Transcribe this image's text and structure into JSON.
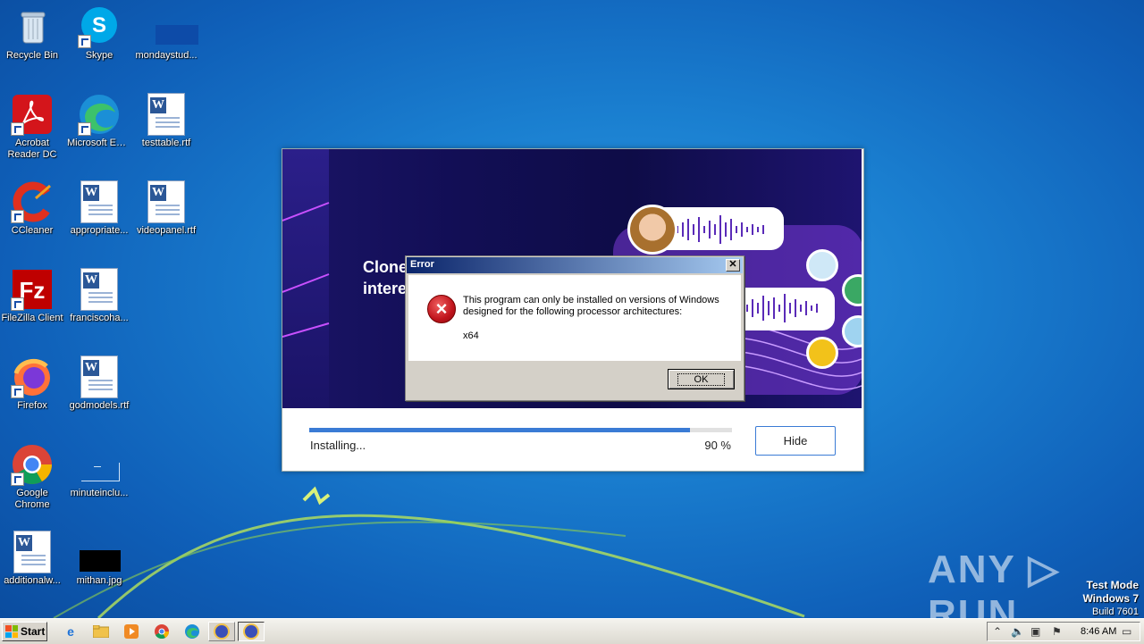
{
  "desktop": {
    "icons": [
      {
        "label": "Recycle Bin"
      },
      {
        "label": "Skype"
      },
      {
        "label": "mondaystud..."
      },
      {
        "label": "Acrobat Reader DC"
      },
      {
        "label": "Microsoft Edge"
      },
      {
        "label": "testtable.rtf"
      },
      {
        "label": "CCleaner"
      },
      {
        "label": "appropriate..."
      },
      {
        "label": "videopanel.rtf"
      },
      {
        "label": "FileZilla Client"
      },
      {
        "label": "franciscoha..."
      },
      {
        "label": "Firefox"
      },
      {
        "label": "godmodels.rtf"
      },
      {
        "label": "Google Chrome"
      },
      {
        "label": "minuteinclu..."
      },
      {
        "label": "additionalw..."
      },
      {
        "label": "mithan.jpg"
      }
    ]
  },
  "installer": {
    "hero_title_line1": "Clone",
    "hero_title_line2": "intere",
    "status": "Installing...",
    "progress_text": "90 %",
    "progress": 0.9,
    "hide_label": "Hide",
    "accent": "#3a7bd5"
  },
  "error_dialog": {
    "title": "Error",
    "close": "✕",
    "message": "This program can only be installed on versions of Windows designed for the following processor architectures:",
    "architecture": "x64",
    "ok_label": "OK"
  },
  "watermark": {
    "brand": "ANY ▷ RUN",
    "test_mode": "Test Mode",
    "os": "Windows 7",
    "build": "Build 7601"
  },
  "taskbar": {
    "start_label": "Start",
    "clock": "8:46 AM"
  }
}
